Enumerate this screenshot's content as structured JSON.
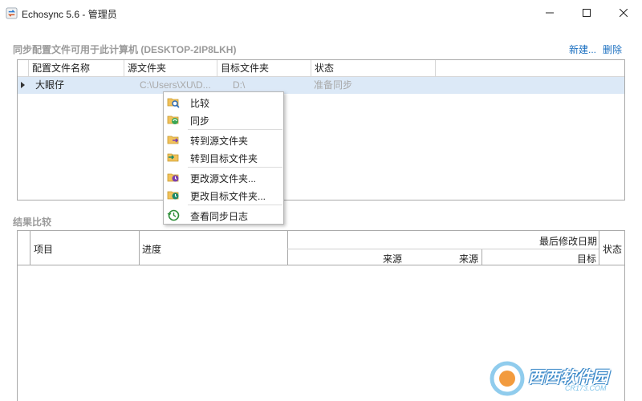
{
  "window": {
    "title": "Echosync 5.6 - 管理员",
    "icon": "echosync-app-icon"
  },
  "profiles_section": {
    "title": "同步配置文件可用于此计算机 (DESKTOP-2IP8LKH)",
    "new_link": "新建...",
    "delete_link": "删除",
    "columns": [
      "配置文件名称",
      "源文件夹",
      "目标文件夹",
      "状态"
    ],
    "rows": [
      {
        "name": "大眼仔",
        "source": "C:\\Users\\XU\\D...",
        "target": "D:\\",
        "status": "准备同步"
      }
    ]
  },
  "context_menu": {
    "items": [
      {
        "label": "比较",
        "icon": "compare-folder-icon"
      },
      {
        "label": "同步",
        "icon": "sync-folder-icon"
      },
      {
        "label": "转到源文件夹",
        "icon": "goto-source-folder-icon"
      },
      {
        "label": "转到目标文件夹",
        "icon": "goto-target-folder-icon"
      },
      {
        "label": "更改源文件夹...",
        "icon": "change-source-folder-icon"
      },
      {
        "label": "更改目标文件夹...",
        "icon": "change-target-folder-icon"
      },
      {
        "label": "查看同步日志",
        "icon": "history-log-icon"
      }
    ]
  },
  "results_section": {
    "title": "结果比较",
    "columns": {
      "item": "项目",
      "progress": "进度",
      "last_modified": "最后修改日期",
      "source_a": "来源",
      "source_b": "来源",
      "target": "目标",
      "status": "状态"
    }
  },
  "watermark": {
    "text": "西西软件园",
    "sub": "CR173.COM"
  },
  "colors": {
    "accent_link": "#1a6fc0",
    "selected_row": "#dce9f7",
    "muted_text": "#a8a8a8"
  }
}
